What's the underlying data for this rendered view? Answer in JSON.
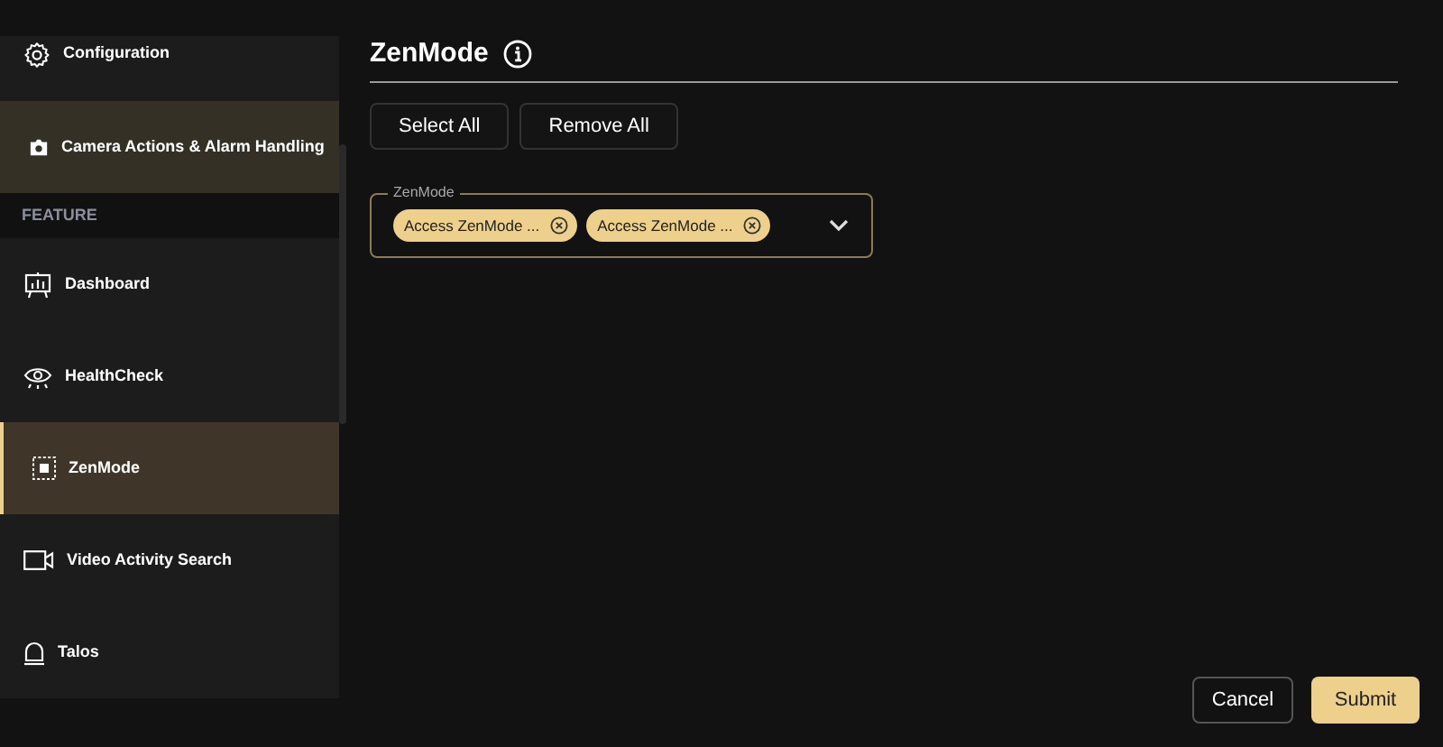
{
  "sidebar": {
    "items": [
      {
        "kind": "item",
        "label": "Configuration",
        "selected": false,
        "highlighted": false
      },
      {
        "kind": "item",
        "label": "Camera Actions & Alarm Handling",
        "selected": false,
        "highlighted": true
      },
      {
        "kind": "header",
        "label": "FEATURE"
      },
      {
        "kind": "item",
        "label": "Dashboard",
        "selected": false,
        "highlighted": false
      },
      {
        "kind": "item",
        "label": "HealthCheck",
        "selected": false,
        "highlighted": false
      },
      {
        "kind": "item",
        "label": "ZenMode",
        "selected": true,
        "highlighted": true
      },
      {
        "kind": "item",
        "label": "Video Activity Search",
        "selected": false,
        "highlighted": false
      },
      {
        "kind": "item",
        "label": "Talos",
        "selected": false,
        "highlighted": false
      }
    ]
  },
  "title": "ZenMode",
  "buttons": [
    "Select All",
    "Remove All"
  ],
  "select": {
    "label": "ZenMode",
    "chips": [
      "Access ZenMode ...",
      "Access ZenMode ..."
    ]
  },
  "footer": {
    "cancel": "Cancel",
    "submit": "Submit"
  }
}
